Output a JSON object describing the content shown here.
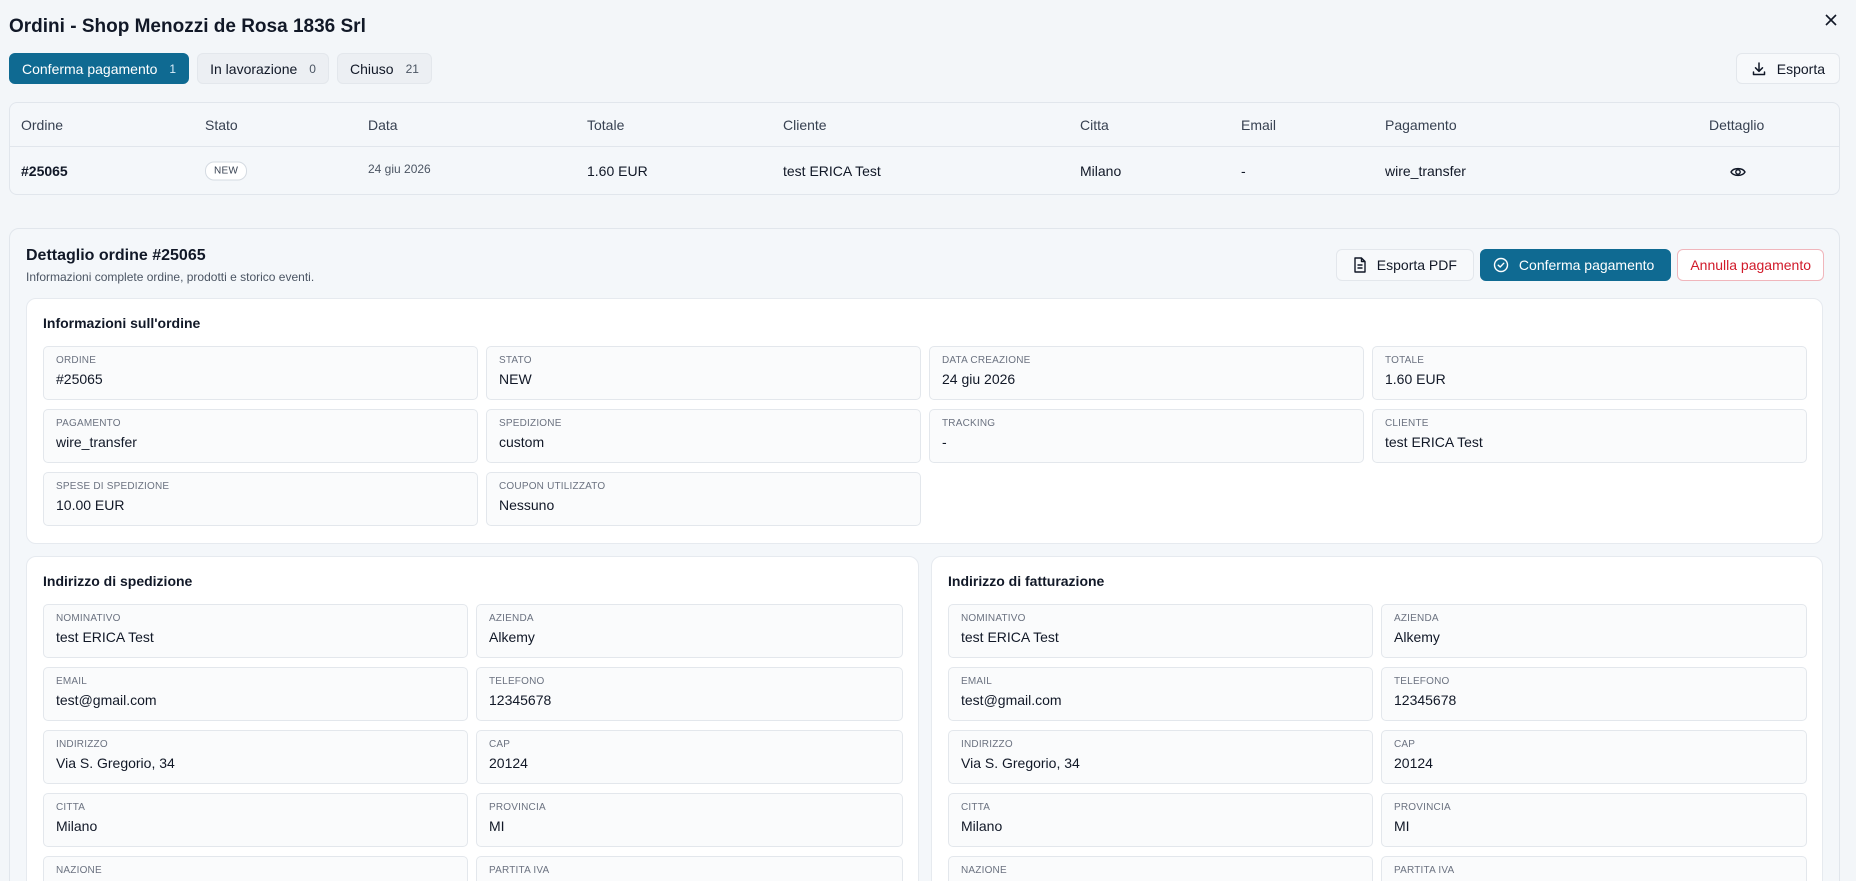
{
  "title": "Ordini - Shop Menozzi de Rosa 1836 Srl",
  "tabs": [
    {
      "label": "Conferma pagamento",
      "count": "1"
    },
    {
      "label": "In lavorazione",
      "count": "0"
    },
    {
      "label": "Chiuso",
      "count": "21"
    }
  ],
  "export_label": "Esporta",
  "table": {
    "headers": [
      "Ordine",
      "Stato",
      "Data",
      "Totale",
      "Cliente",
      "Citta",
      "Email",
      "Pagamento",
      "Dettaglio"
    ],
    "row": {
      "order": "#25065",
      "status": "NEW",
      "date": "24 giu 2026",
      "total": "1.60 EUR",
      "customer": "test ERICA Test",
      "city": "Milano",
      "email": "-",
      "payment": "wire_transfer"
    }
  },
  "detail": {
    "title": "Dettaglio ordine #25065",
    "subtitle": "Informazioni complete ordine, prodotti e storico eventi.",
    "export_pdf": "Esporta PDF",
    "confirm": "Conferma pagamento",
    "cancel": "Annulla pagamento"
  },
  "order_info": {
    "title": "Informazioni sull'ordine",
    "fields": [
      {
        "label": "ORDINE",
        "value": "#25065"
      },
      {
        "label": "STATO",
        "value": "NEW"
      },
      {
        "label": "DATA CREAZIONE",
        "value": "24 giu 2026"
      },
      {
        "label": "TOTALE",
        "value": "1.60 EUR"
      },
      {
        "label": "PAGAMENTO",
        "value": "wire_transfer"
      },
      {
        "label": "SPEDIZIONE",
        "value": "custom"
      },
      {
        "label": "TRACKING",
        "value": "-"
      },
      {
        "label": "CLIENTE",
        "value": "test ERICA Test"
      },
      {
        "label": "SPESE DI SPEDIZIONE",
        "value": "10.00 EUR"
      },
      {
        "label": "COUPON UTILIZZATO",
        "value": "Nessuno"
      }
    ]
  },
  "shipping": {
    "title": "Indirizzo di spedizione",
    "fields": [
      {
        "label": "NOMINATIVO",
        "value": "test ERICA Test"
      },
      {
        "label": "AZIENDA",
        "value": "Alkemy"
      },
      {
        "label": "EMAIL",
        "value": "test@gmail.com"
      },
      {
        "label": "TELEFONO",
        "value": "12345678"
      },
      {
        "label": "INDIRIZZO",
        "value": "Via S. Gregorio, 34"
      },
      {
        "label": "CAP",
        "value": "20124"
      },
      {
        "label": "CITTA",
        "value": "Milano"
      },
      {
        "label": "PROVINCIA",
        "value": "MI"
      },
      {
        "label": "NAZIONE",
        "value": ""
      },
      {
        "label": "PARTITA IVA",
        "value": ""
      }
    ]
  },
  "billing": {
    "title": "Indirizzo di fatturazione",
    "fields": [
      {
        "label": "NOMINATIVO",
        "value": "test ERICA Test"
      },
      {
        "label": "AZIENDA",
        "value": "Alkemy"
      },
      {
        "label": "EMAIL",
        "value": "test@gmail.com"
      },
      {
        "label": "TELEFONO",
        "value": "12345678"
      },
      {
        "label": "INDIRIZZO",
        "value": "Via S. Gregorio, 34"
      },
      {
        "label": "CAP",
        "value": "20124"
      },
      {
        "label": "CITTA",
        "value": "Milano"
      },
      {
        "label": "PROVINCIA",
        "value": "MI"
      },
      {
        "label": "NAZIONE",
        "value": ""
      },
      {
        "label": "PARTITA IVA",
        "value": ""
      }
    ]
  }
}
